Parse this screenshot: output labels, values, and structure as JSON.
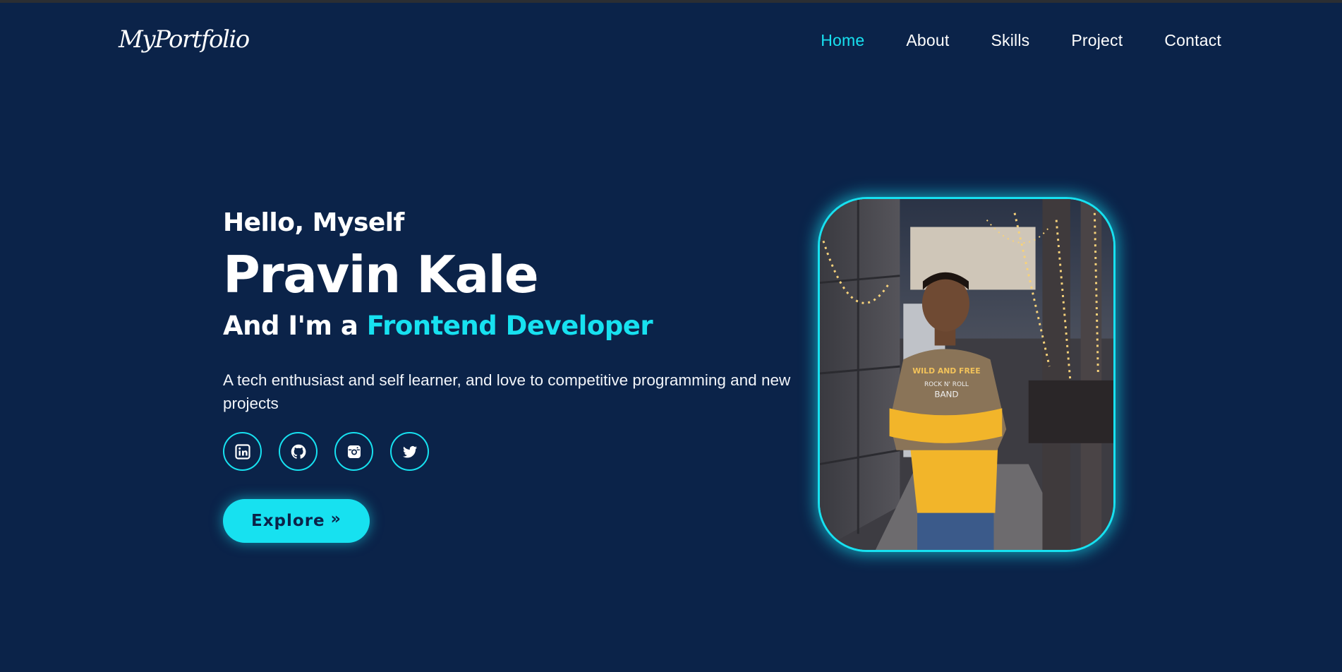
{
  "nav": {
    "logo": "MyPortfolio",
    "links": [
      {
        "label": "Home",
        "active": true
      },
      {
        "label": "About",
        "active": false
      },
      {
        "label": "Skills",
        "active": false
      },
      {
        "label": "Project",
        "active": false
      },
      {
        "label": "Contact",
        "active": false
      }
    ]
  },
  "hero": {
    "greeting": "Hello, Myself",
    "name": "Pravin Kale",
    "role_prefix": "And I'm a",
    "role_highlight": "Frontend Developer",
    "description": "A tech enthusiast and self learner, and love to competitive programming and new projects",
    "socials": [
      {
        "icon": "linkedin-icon"
      },
      {
        "icon": "github-icon"
      },
      {
        "icon": "instagram-icon"
      },
      {
        "icon": "twitter-icon"
      }
    ],
    "cta_label": "Explore",
    "cta_icon": "double-chevron-right-icon"
  },
  "photo": {
    "shirt_text_1": "WILD AND FREE",
    "shirt_text_2": "ROCK N' ROLL",
    "shirt_text_3": "BAND"
  },
  "colors": {
    "background": "#0b2349",
    "accent": "#17e1f0",
    "text": "#ffffff"
  }
}
